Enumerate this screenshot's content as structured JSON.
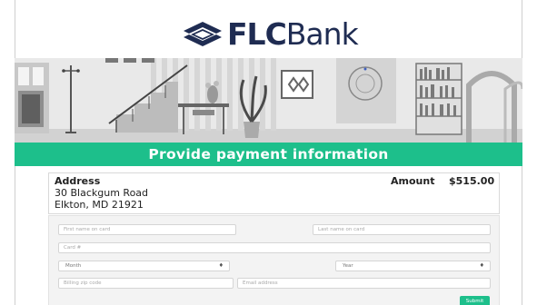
{
  "brand": {
    "name_part1": "FLC",
    "name_part2": "Bank",
    "accent_color": "#1dbf8b",
    "navy_color": "#1f2c52"
  },
  "banner": {
    "title": "Provide payment information"
  },
  "address": {
    "heading": "Address",
    "line1": "30 Blackgum Road",
    "line2": "Elkton, MD 21921"
  },
  "amount": {
    "label": "Amount",
    "value": "$515.00"
  },
  "form": {
    "first_name_placeholder": "First name on card",
    "last_name_placeholder": "Last name on card",
    "card_placeholder": "Card #",
    "month_label": "Month",
    "year_label": "Year",
    "zip_placeholder": "Billing zip code",
    "email_placeholder": "Email address",
    "submit_label": "Submit"
  }
}
